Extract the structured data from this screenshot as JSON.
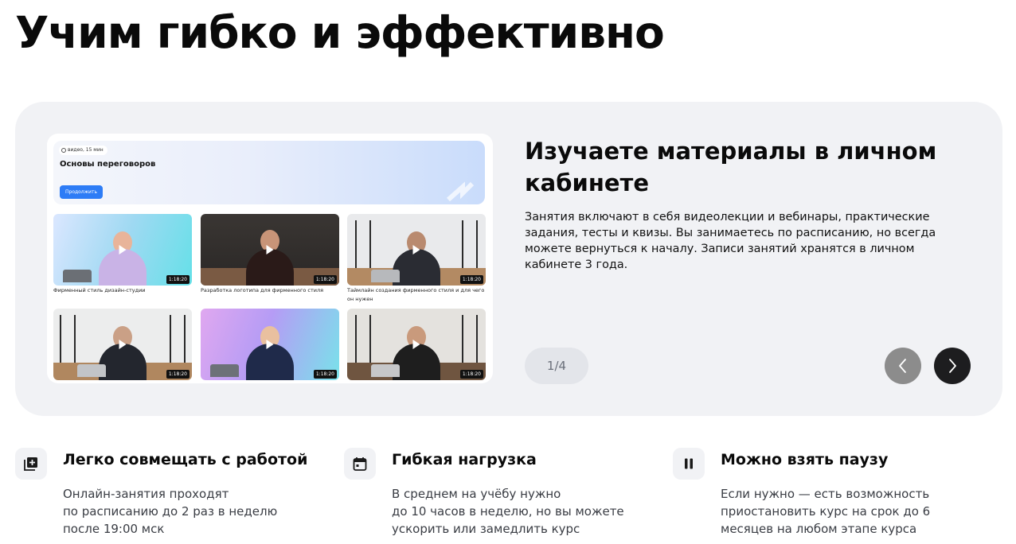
{
  "page_title": "Учим гибко и эффективно",
  "slide": {
    "title": "Изучаете материалы в личном кабинете",
    "text": "Занятия включают в себя видеолекции и вебинары, практические задания, тесты и квизы. Вы занимаетесь по расписанию, но всегда можете вернуться к началу. Записи занятий хранятся в личном кабинете 3 года.",
    "counter": "1/4",
    "prev_icon": "chevron-left-icon",
    "next_icon": "chevron-right-icon"
  },
  "preview": {
    "badge": "видео, 15 мин",
    "course_title": "Основы переговоров",
    "continue_label": "Продолжить",
    "videos": [
      {
        "caption": "Фирменный стиль дизайн-студии",
        "duration": "1:18:20"
      },
      {
        "caption": "Разработка логотипа для фирменного стиля",
        "duration": "1:18:20"
      },
      {
        "caption": "Таймлайн создания фирменного стиля и для чего он нужен",
        "duration": "1:18:20"
      },
      {
        "caption": "",
        "duration": "1:18:20"
      },
      {
        "caption": "",
        "duration": "1:18:20"
      },
      {
        "caption": "",
        "duration": "1:18:20"
      }
    ]
  },
  "features": [
    {
      "icon": "add-library-icon",
      "title": "Легко совмещать с работой",
      "lines": [
        "Онлайн-занятия проходят",
        "по расписанию до 2 раз в неделю",
        "после 19:00 мск"
      ]
    },
    {
      "icon": "calendar-icon",
      "title": "Гибкая нагрузка",
      "lines": [
        "В среднем на учёбу нужно",
        "до 10 часов в неделю, но вы можете",
        "ускорить или замедлить курс"
      ]
    },
    {
      "icon": "pause-icon",
      "title": "Можно взять паузу",
      "lines": [
        "Если нужно — есть возможность",
        "приостановить курс на срок до 6",
        "месяцев на любом этапе курса"
      ]
    }
  ]
}
